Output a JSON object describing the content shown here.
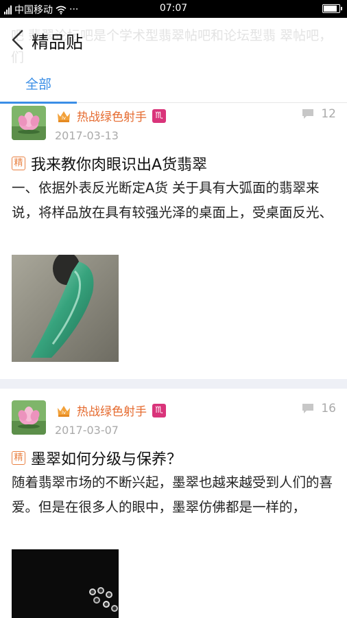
{
  "status_bar": {
    "carrier": "中国移动",
    "more": "···",
    "time": "07:07",
    "battery_level": 0.9
  },
  "header": {
    "background_text": "吧 翡翠论坛吧是个学术型翡翠帖吧和论坛型翡 翠帖吧，们",
    "title": "精品贴",
    "back_icon": "chevron-left-icon"
  },
  "tabs": [
    {
      "label": "全部",
      "active": true
    }
  ],
  "colors": {
    "accent": "#3a8ee6",
    "author": "#e56a2e",
    "level_badge": "#d9347a",
    "divider": "#eef0f6"
  },
  "posts": [
    {
      "author": "热战绿色射手",
      "level_badge": "♏",
      "date": "2017-03-13",
      "reply_count": "12",
      "tag": "精",
      "title": "我来教你肉眼识出A货翡翠",
      "excerpt": "一、依据外表反光断定A货 关于具有大弧面的翡翠来说，将样品放在具有较强光泽的桌面上，受桌面反光、",
      "image": "jade-pendant-photo"
    },
    {
      "author": "热战绿色射手",
      "level_badge": "♏",
      "date": "2017-03-07",
      "reply_count": "16",
      "tag": "精",
      "title": "墨翠如何分级与保养？",
      "excerpt": "随着翡翠市场的不断兴起，墨翠也越来越受到人们的喜爱。但是在很多人的眼中，墨翠仿佛都是一样的，",
      "image": "black-jade-photo"
    }
  ]
}
